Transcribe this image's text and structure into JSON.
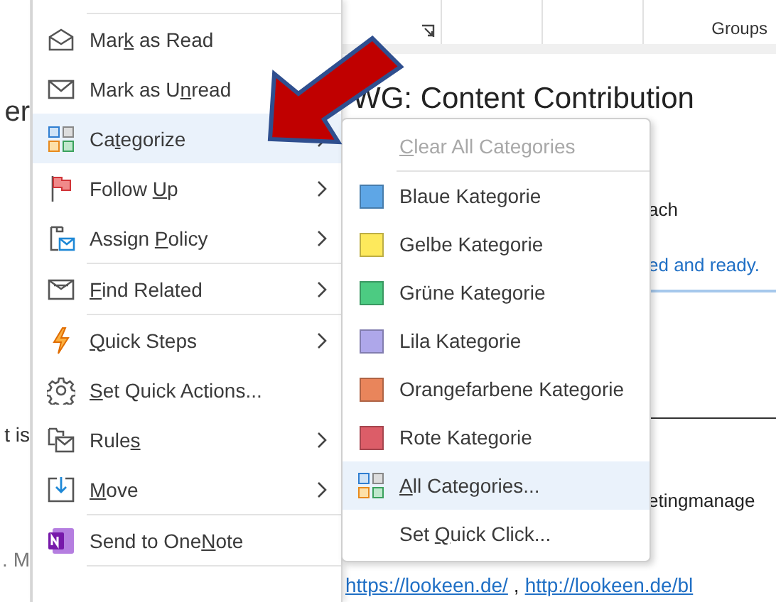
{
  "ribbon": {
    "group_label": "Groups"
  },
  "left_strip": {
    "texts": [
      "er",
      "t is",
      ". M"
    ]
  },
  "reading_pane": {
    "subject": "WG: Content Contribution",
    "line_1": "ach",
    "line_2": "ed and ready.",
    "line_3": "etingmanage",
    "links": [
      "https://lookeen.de/",
      "http://lookeen.de/bl"
    ],
    "separator": ","
  },
  "context_menu": {
    "items": [
      {
        "kind": "read",
        "before": "Mar",
        "key": "k",
        "after": " as Read",
        "submenu": false,
        "selected": false,
        "divider_after": false
      },
      {
        "kind": "unread",
        "before": "Mark as U",
        "key": "n",
        "after": "read",
        "submenu": false,
        "selected": false,
        "divider_after": false
      },
      {
        "kind": "categorize",
        "before": "Ca",
        "key": "t",
        "after": "egorize",
        "submenu": true,
        "selected": true,
        "divider_after": false
      },
      {
        "kind": "flag",
        "before": "Follow ",
        "key": "U",
        "after": "p",
        "submenu": true,
        "selected": false,
        "divider_after": false
      },
      {
        "kind": "policy",
        "before": "Assign ",
        "key": "P",
        "after": "olicy",
        "submenu": true,
        "selected": false,
        "divider_after": true
      },
      {
        "kind": "find",
        "key": "F",
        "after": "ind Related",
        "submenu": true,
        "selected": false,
        "divider_after": true
      },
      {
        "kind": "steps",
        "key": "Q",
        "after": "uick Steps",
        "submenu": true,
        "selected": false,
        "divider_after": false
      },
      {
        "kind": "gear",
        "key": "S",
        "after": "et Quick Actions...",
        "submenu": false,
        "selected": false,
        "divider_after": false
      },
      {
        "kind": "rules",
        "before": "Rule",
        "key": "s",
        "submenu": true,
        "selected": false,
        "divider_after": false
      },
      {
        "kind": "move",
        "key": "M",
        "after": "ove",
        "submenu": true,
        "selected": false,
        "divider_after": true
      },
      {
        "kind": "onenote",
        "before": "Send to One",
        "key": "N",
        "after": "ote",
        "submenu": false,
        "selected": false,
        "divider_after": true
      }
    ]
  },
  "category_menu": {
    "items": [
      {
        "kind": "action",
        "key": "C",
        "after": "lear All Categories",
        "disabled": true,
        "selected": false,
        "divider_after": true
      },
      {
        "kind": "category",
        "before": "Blaue Kategorie",
        "color": "#5ea6e6",
        "disabled": false,
        "selected": false,
        "divider_after": false
      },
      {
        "kind": "category",
        "before": "Gelbe Kategorie",
        "color": "#fde95c",
        "disabled": false,
        "selected": false,
        "divider_after": false
      },
      {
        "kind": "category",
        "before": "Grüne Kategorie",
        "color": "#4ccb82",
        "disabled": false,
        "selected": false,
        "divider_after": false
      },
      {
        "kind": "category",
        "before": "Lila Kategorie",
        "color": "#aea7ea",
        "disabled": false,
        "selected": false,
        "divider_after": false
      },
      {
        "kind": "category",
        "before": "Orangefarbene Kategorie",
        "color": "#e9855b",
        "disabled": false,
        "selected": false,
        "divider_after": false
      },
      {
        "kind": "category",
        "before": "Rote Kategorie",
        "color": "#dc5d68",
        "disabled": false,
        "selected": false,
        "divider_after": false
      },
      {
        "kind": "all",
        "key": "A",
        "after": "ll Categories...",
        "disabled": false,
        "selected": true,
        "divider_after": false
      },
      {
        "kind": "action",
        "before": "Set ",
        "key": "Q",
        "after": "uick Click...",
        "disabled": false,
        "selected": false,
        "divider_after": false
      }
    ]
  }
}
